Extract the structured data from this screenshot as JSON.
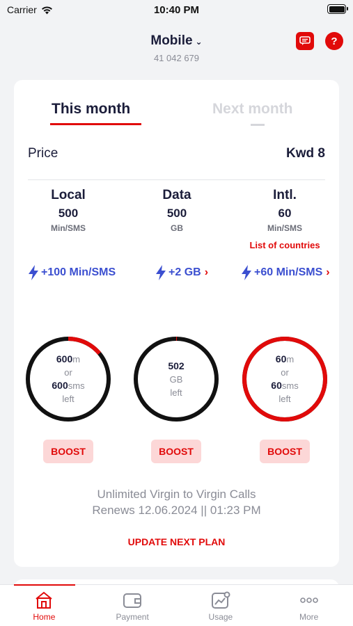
{
  "status_bar": {
    "carrier": "Carrier",
    "time": "10:40 PM"
  },
  "header": {
    "title": "Mobile",
    "line_number": "41 042 679"
  },
  "tabs": {
    "this_month": "This month",
    "next_month": "Next month"
  },
  "price": {
    "label": "Price",
    "value": "Kwd 8"
  },
  "allowances": {
    "local": {
      "title": "Local",
      "amount": "500",
      "unit": "Min/SMS"
    },
    "data": {
      "title": "Data",
      "amount": "500",
      "unit": "GB"
    },
    "intl": {
      "title": "Intl.",
      "amount": "60",
      "unit": "Min/SMS",
      "link": "List of countries"
    }
  },
  "addons": {
    "local": "+100 Min/SMS",
    "data": "+2 GB",
    "intl": "+60 Min/SMS"
  },
  "rings": {
    "local": {
      "value1": "600",
      "unit1": "m",
      "or": "or",
      "value2": "600",
      "unit2": "sms",
      "suffix": "left",
      "used_fraction": 0.14
    },
    "data": {
      "value": "502",
      "unit": "GB",
      "suffix": "left",
      "used_fraction": 0.003
    },
    "intl": {
      "value1": "60",
      "unit1": "m",
      "or": "or",
      "value2": "60",
      "unit2": "sms",
      "suffix": "left",
      "used_fraction": 1.0
    }
  },
  "boost_label": "BOOST",
  "info": {
    "unlimited": "Unlimited Virgin to Virgin Calls",
    "renews": "Renews 12.06.2024 || 01:23 PM"
  },
  "update_link": "UPDATE NEXT PLAN",
  "tabbar": {
    "home": "Home",
    "payment": "Payment",
    "usage": "Usage",
    "more": "More"
  },
  "colors": {
    "accent": "#e10a0a",
    "addon_blue": "#3b4fd0",
    "ring_track": "#111111"
  }
}
